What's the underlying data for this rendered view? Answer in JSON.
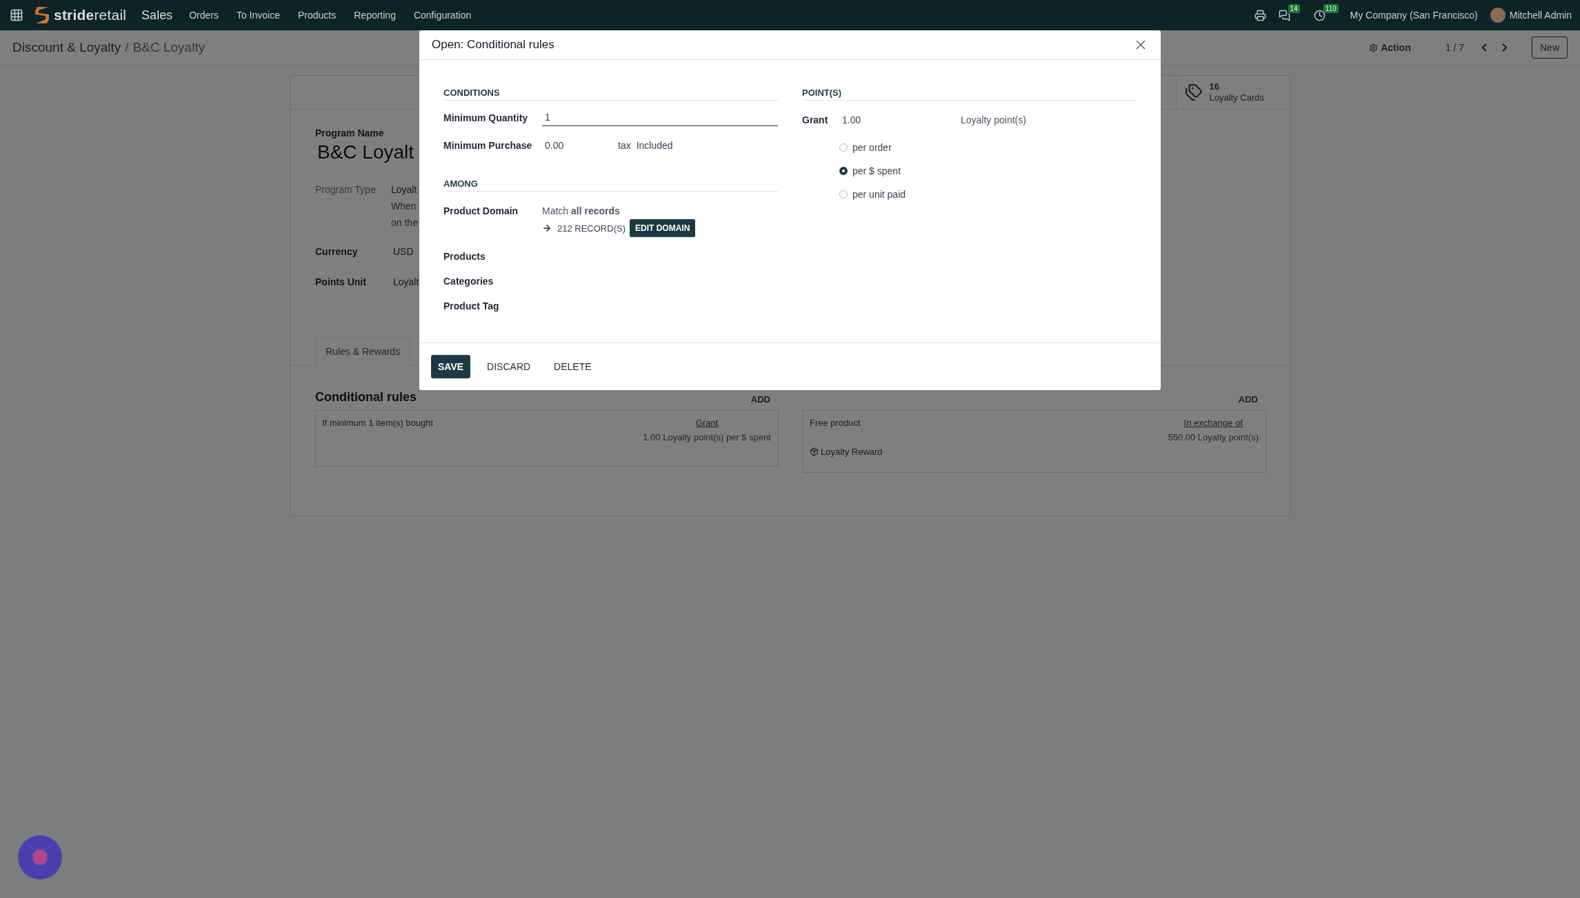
{
  "navbar": {
    "logo": {
      "strong": "stride",
      "light": "retail"
    },
    "app": "Sales",
    "menu": [
      "Orders",
      "To Invoice",
      "Products",
      "Reporting",
      "Configuration"
    ],
    "messages_badge": "14",
    "activities_badge": "110",
    "company": "My Company (San Francisco)",
    "user": "Mitchell Admin"
  },
  "breadcrumb": {
    "parent": "Discount & Loyalty",
    "separator": "/",
    "current": "B&C Loyalty"
  },
  "control_panel": {
    "action": "Action",
    "pager": "1 / 7",
    "new_button": "New"
  },
  "form": {
    "stat_button": {
      "value": "16",
      "label": "Loyalty Cards"
    },
    "program_name_label": "Program Name",
    "program_name": "B&C Loyalt",
    "program_type": {
      "label": "Program Type",
      "value": "Loyalt",
      "description": [
        "When",
        "on the"
      ]
    },
    "currency": {
      "label": "Currency",
      "value": "USD"
    },
    "points_unit": {
      "label": "Points Unit",
      "value": "Loyalt"
    },
    "tabs": [
      {
        "label": "Rules & Rewards",
        "selected": true
      }
    ],
    "rules": {
      "title": "Conditional rules",
      "add": "ADD",
      "items": [
        {
          "text": "If minimum 1 item(s) bought",
          "link": "Grant",
          "detail": "1.00 Loyalty point(s) per $ spent"
        }
      ]
    },
    "rewards": {
      "add": "ADD",
      "items": [
        {
          "text": "Free product",
          "link": "In exchange of",
          "detail": "550.00 Loyalty point(s)",
          "product": "Loyalty Reward"
        }
      ]
    }
  },
  "modal": {
    "title": "Open: Conditional rules",
    "conditions": {
      "heading": "CONDITIONS",
      "min_quantity": {
        "label": "Minimum Quantity",
        "value": "1"
      },
      "min_purchase": {
        "label": "Minimum Purchase",
        "value": "0.00",
        "tax_label": "tax",
        "tax_value": "Included"
      }
    },
    "among": {
      "heading": "AMONG",
      "domain_label": "Product Domain",
      "domain_match": "Match **all records**",
      "records": "212 RECORD(S)",
      "edit_button": "EDIT DOMAIN",
      "fields": [
        "Products",
        "Categories",
        "Product Tag"
      ]
    },
    "points": {
      "heading": "POINT(S)",
      "grant_label": "Grant",
      "grant_value": "1.00",
      "unit": "Loyalty point(s)",
      "modes": [
        {
          "label": "per order",
          "selected": false
        },
        {
          "label": "per $ spent",
          "selected": true
        },
        {
          "label": "per unit paid",
          "selected": false
        }
      ]
    },
    "buttons": [
      {
        "label": "SAVE",
        "kind": "primary"
      },
      {
        "label": "DISCARD",
        "kind": "link"
      },
      {
        "label": "DELETE",
        "kind": "link"
      }
    ]
  }
}
